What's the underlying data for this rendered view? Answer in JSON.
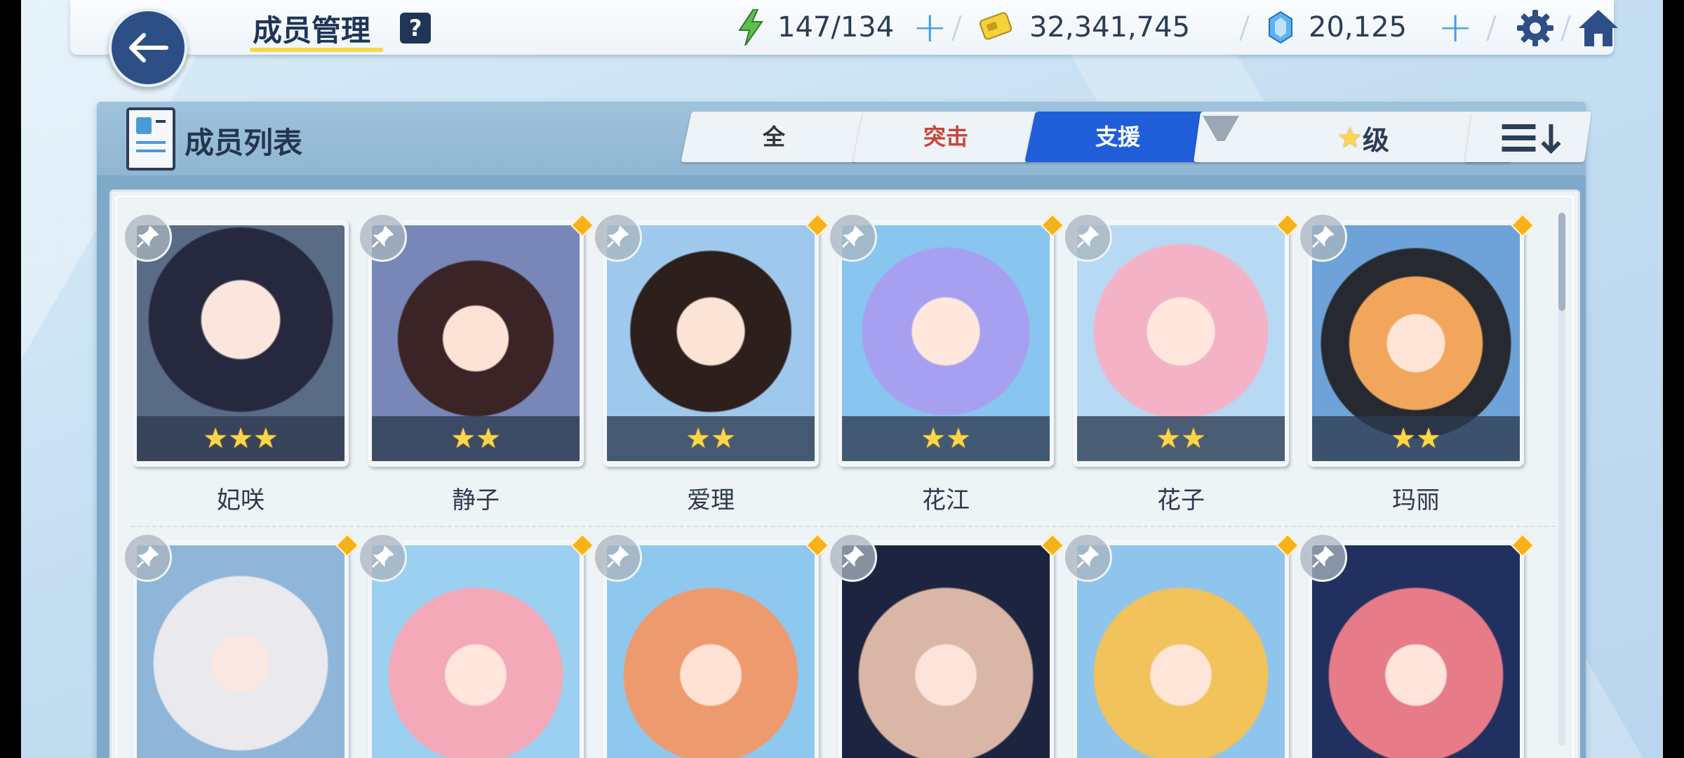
{
  "header": {
    "title": "成员管理",
    "help": "?",
    "stamina": "147/134",
    "credits": "32,341,745",
    "gems": "20,125"
  },
  "panel": {
    "title": "成员列表",
    "tabs": [
      {
        "label": "全",
        "color": "#333333",
        "active": false
      },
      {
        "label": "突击",
        "color": "#c8453b",
        "active": false
      },
      {
        "label": "支援",
        "color": "#ffffff",
        "active": true
      }
    ],
    "filter_label": "级"
  },
  "members": [
    {
      "name": "妃咲",
      "stars": "★★★"
    },
    {
      "name": "静子",
      "stars": "★★"
    },
    {
      "name": "爱理",
      "stars": "★★"
    },
    {
      "name": "花江",
      "stars": "★★"
    },
    {
      "name": "花子",
      "stars": "★★"
    },
    {
      "name": "玛丽",
      "stars": "★★"
    },
    {
      "name": "",
      "stars": ""
    },
    {
      "name": "",
      "stars": ""
    },
    {
      "name": "",
      "stars": ""
    },
    {
      "name": "",
      "stars": ""
    },
    {
      "name": "",
      "stars": ""
    },
    {
      "name": "",
      "stars": ""
    }
  ],
  "colors": {
    "accent": "#1f5ed8",
    "navy": "#2e4f86",
    "star": "#ffd64a",
    "new_dot": "#f7b21a"
  }
}
